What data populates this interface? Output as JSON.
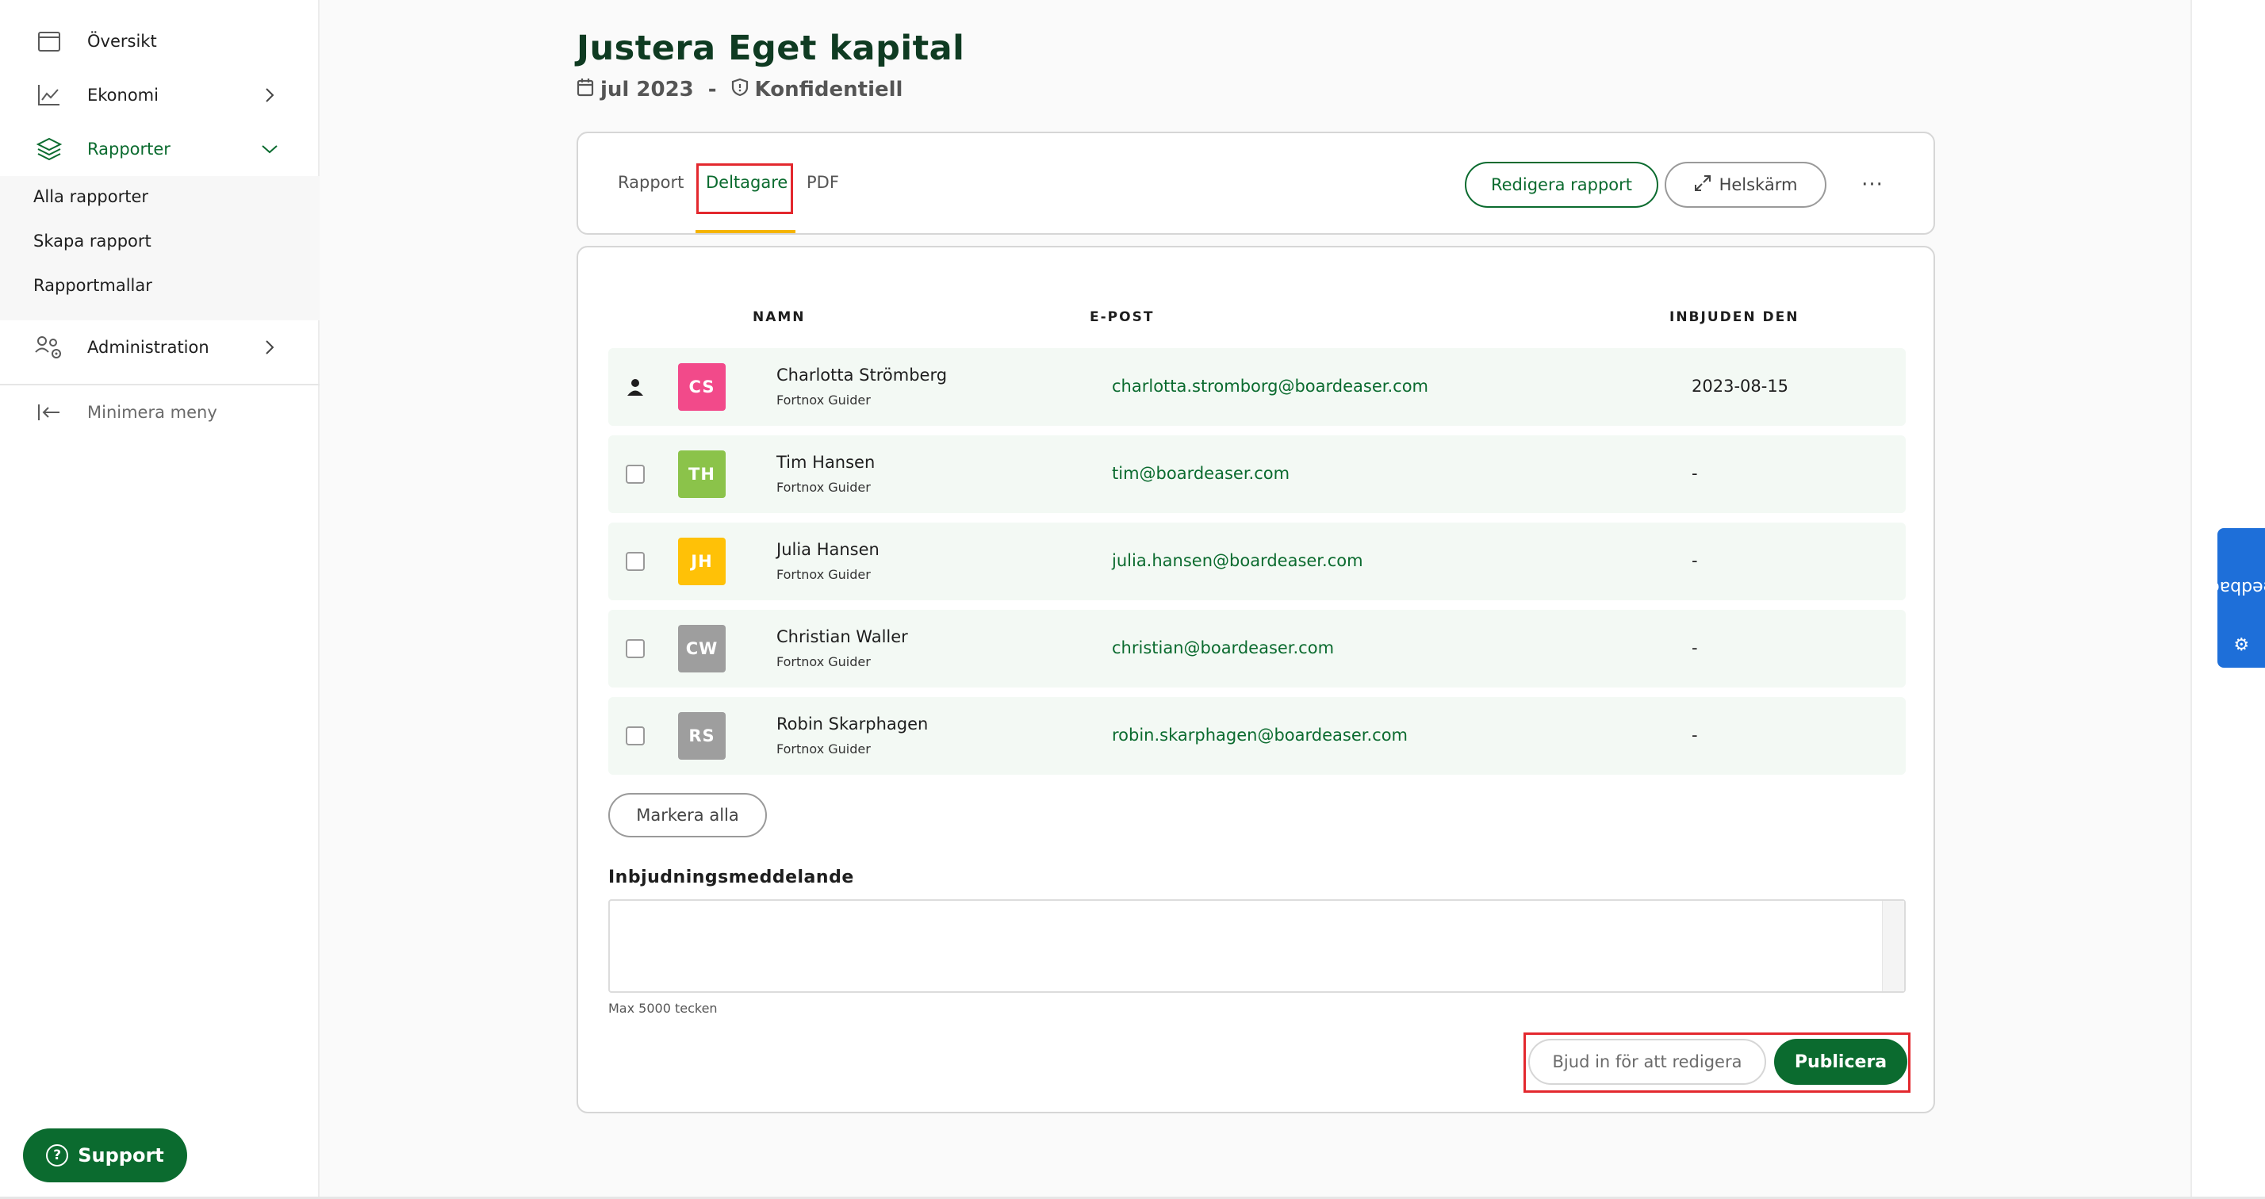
{
  "sidebar": {
    "items": [
      {
        "label": "Översikt",
        "icon": "calendar-icon"
      },
      {
        "label": "Ekonomi",
        "icon": "chart-line-icon"
      },
      {
        "label": "Rapporter",
        "icon": "layers-icon"
      },
      {
        "label": "Administration",
        "icon": "users-gear-icon"
      }
    ],
    "sub_items": [
      "Alla rapporter",
      "Skapa rapport",
      "Rapportmallar"
    ],
    "minimize_label": "Minimera meny",
    "support_label": "Support"
  },
  "header": {
    "title": "Justera Eget kapital",
    "period": "jul 2023",
    "separator": "-",
    "confidentiality": "Konfidentiell"
  },
  "tabs": [
    {
      "label": "Rapport",
      "active": false
    },
    {
      "label": "Deltagare",
      "active": true
    },
    {
      "label": "PDF",
      "active": false
    }
  ],
  "toolbar": {
    "edit_label": "Redigera rapport",
    "fullscreen_label": "Helskärm",
    "more_label": "···"
  },
  "table": {
    "columns": [
      "NAMN",
      "E-POST",
      "INBJUDEN DEN"
    ],
    "rows": [
      {
        "initials": "CS",
        "name": "Charlotta Strömberg",
        "org": "Fortnox Guider",
        "email": "charlotta.stromborg@boardeaser.com",
        "invited": "2023-08-15",
        "owner": true,
        "color": "#f24a8a"
      },
      {
        "initials": "TH",
        "name": "Tim Hansen",
        "org": "Fortnox Guider",
        "email": "tim@boardeaser.com",
        "invited": "-",
        "owner": false,
        "color": "#8bc34a"
      },
      {
        "initials": "JH",
        "name": "Julia Hansen",
        "org": "Fortnox Guider",
        "email": "julia.hansen@boardeaser.com",
        "invited": "-",
        "owner": false,
        "color": "#ffc107"
      },
      {
        "initials": "CW",
        "name": "Christian Waller",
        "org": "Fortnox Guider",
        "email": "christian@boardeaser.com",
        "invited": "-",
        "owner": false,
        "color": "#9e9e9e"
      },
      {
        "initials": "RS",
        "name": "Robin Skarphagen",
        "org": "Fortnox Guider",
        "email": "robin.skarphagen@boardeaser.com",
        "invited": "-",
        "owner": false,
        "color": "#9e9e9e"
      }
    ]
  },
  "actions": {
    "mark_all_label": "Markera alla",
    "message_label": "Inbjudningsmeddelande",
    "message_value": "",
    "max_note": "Max 5000 tecken",
    "invite_label": "Bjud in för att redigera",
    "publish_label": "Publicera"
  },
  "feedback_label": "Feedback",
  "colors": {
    "brand_green": "#0b6b2f",
    "accent_yellow": "#f5b400",
    "highlight_red": "#e3282e",
    "feedback_blue": "#1e6fd9"
  }
}
